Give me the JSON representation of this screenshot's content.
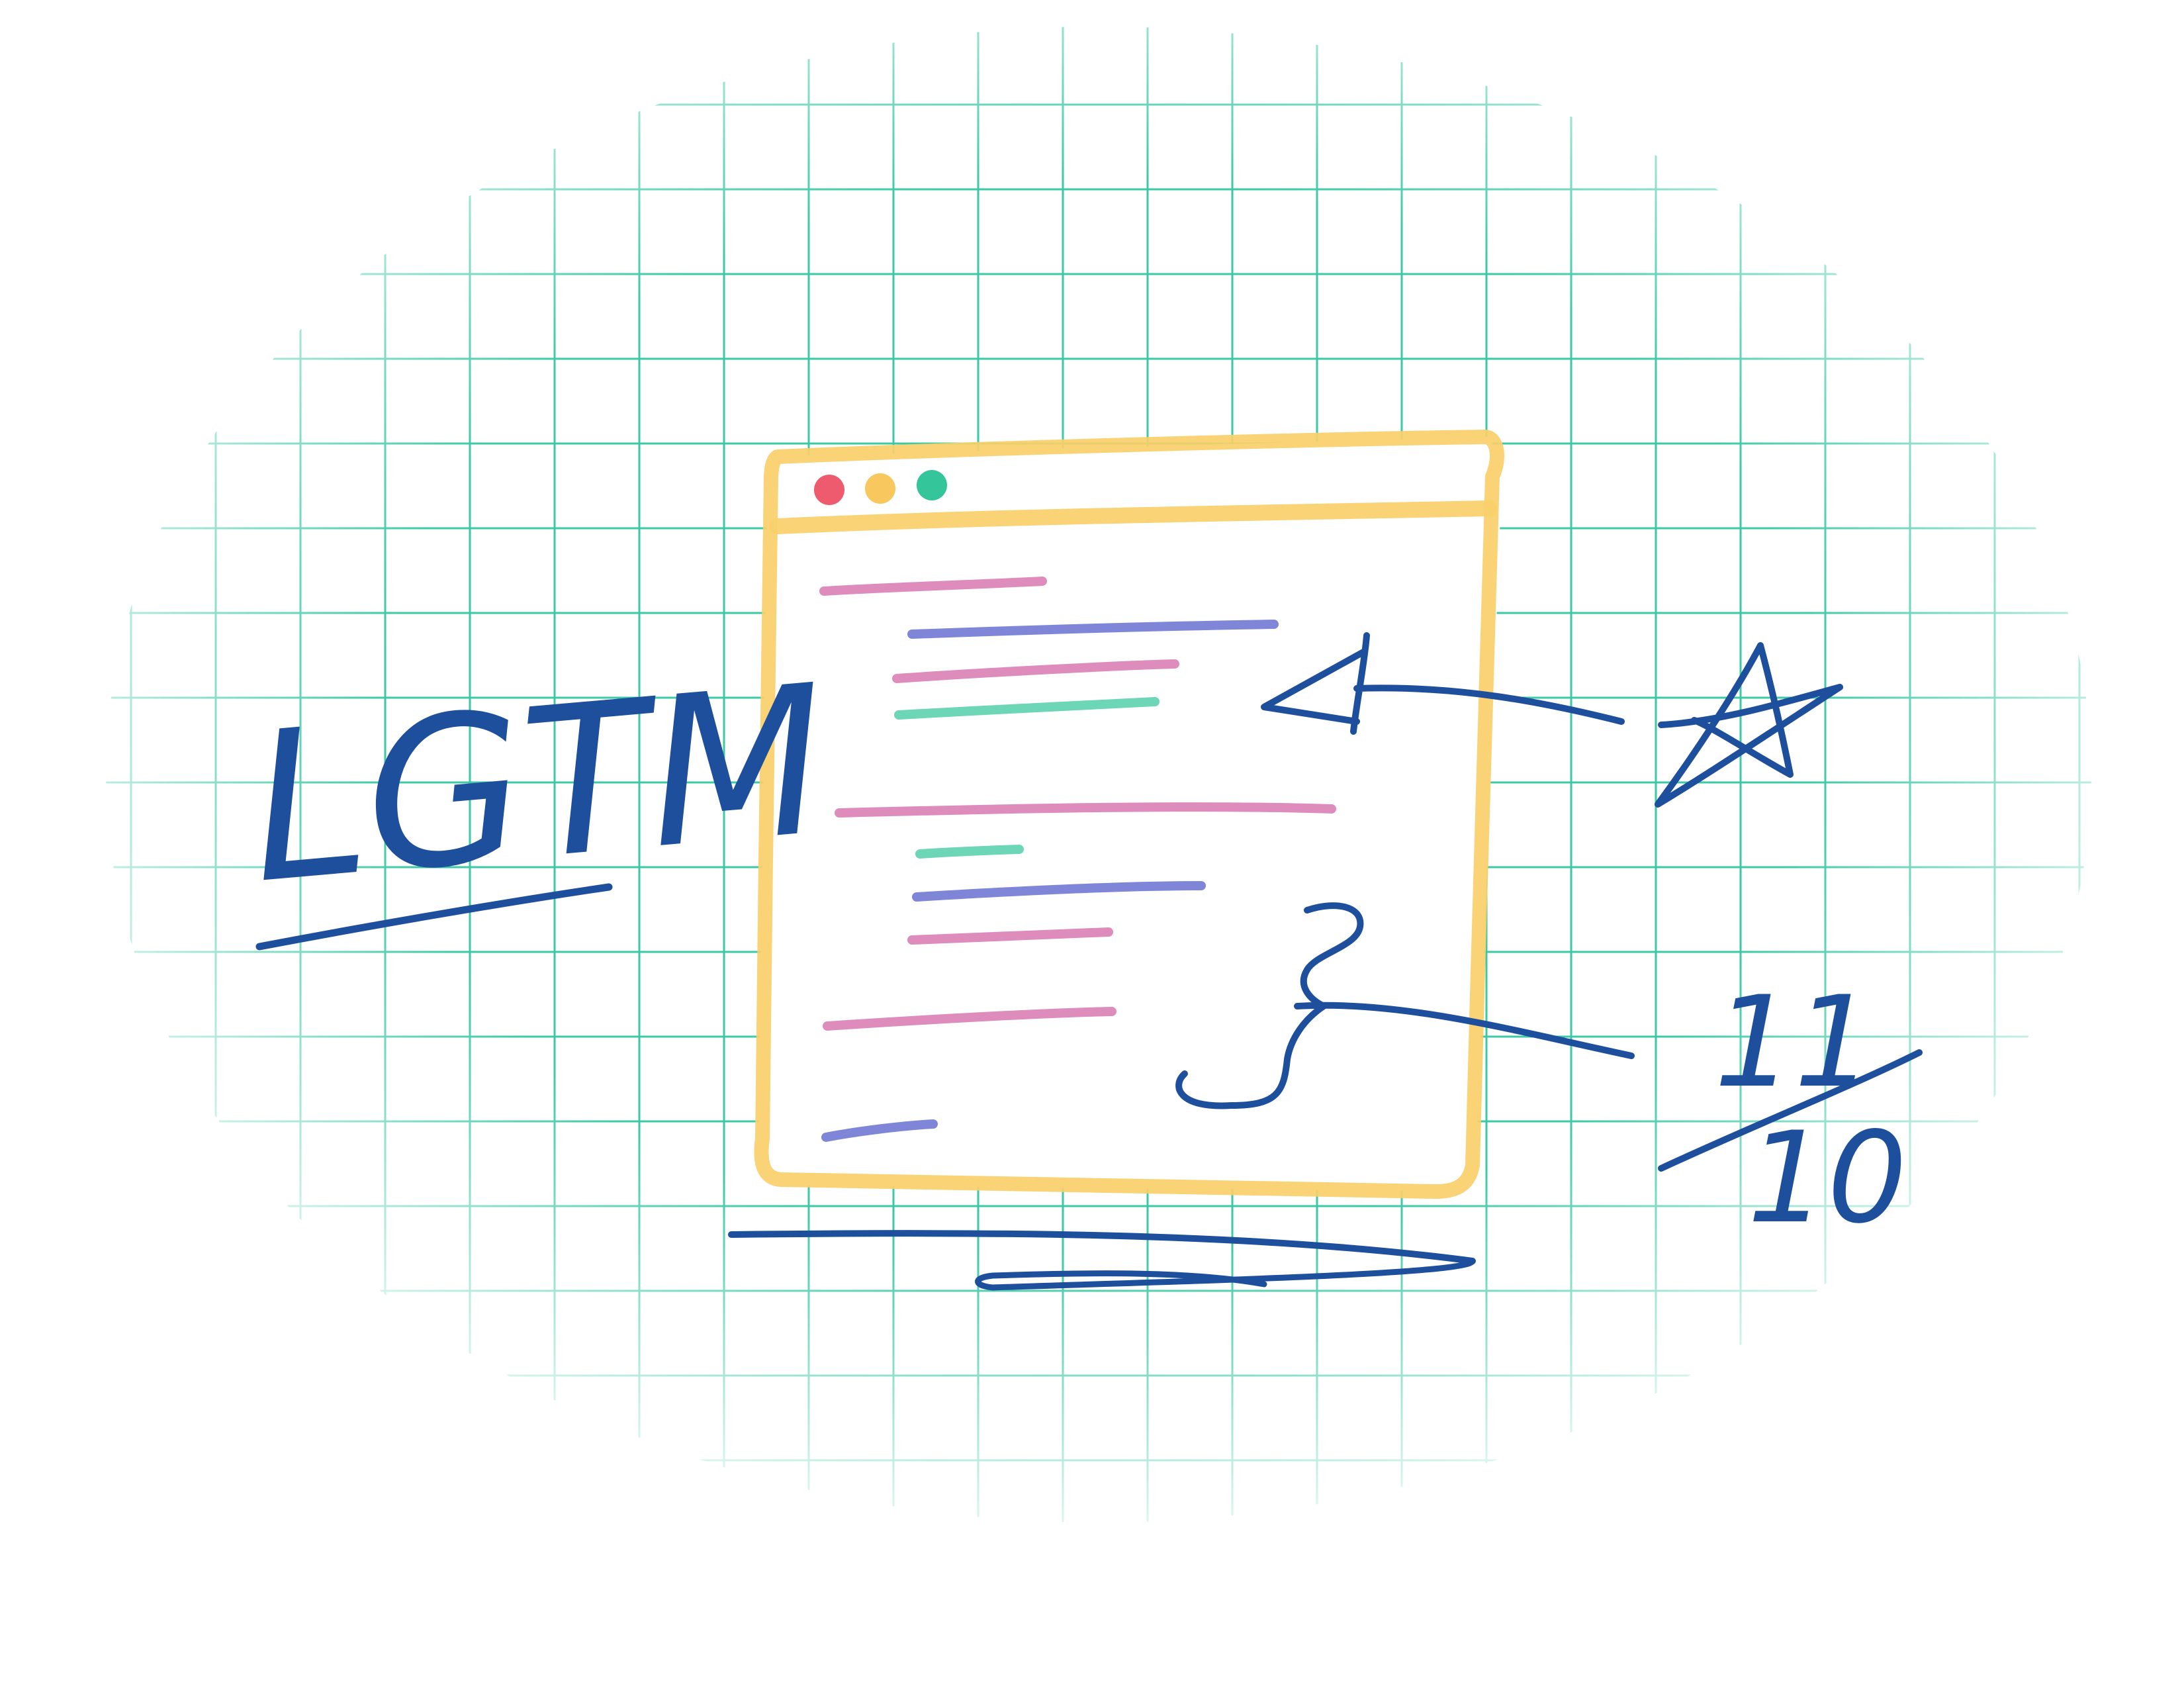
{
  "illustration": {
    "note_text": "LGTM",
    "rating_numerator": "11",
    "rating_denominator": "10",
    "window_controls": [
      "close-dot",
      "minimize-dot",
      "maximize-dot"
    ],
    "icons": [
      "star-icon",
      "arrow-icon",
      "curly-brace-icon"
    ]
  },
  "colors": {
    "grid": "#3dc9a4",
    "window_frame": "#f8cf6a",
    "ink": "#1e4f9c",
    "dot_red": "#ee5a6e",
    "dot_yellow": "#f8c85e",
    "dot_green": "#34c59a",
    "code_pink": "#de8cbc",
    "code_purple": "#7f86d8",
    "code_green": "#6cd6b6"
  }
}
